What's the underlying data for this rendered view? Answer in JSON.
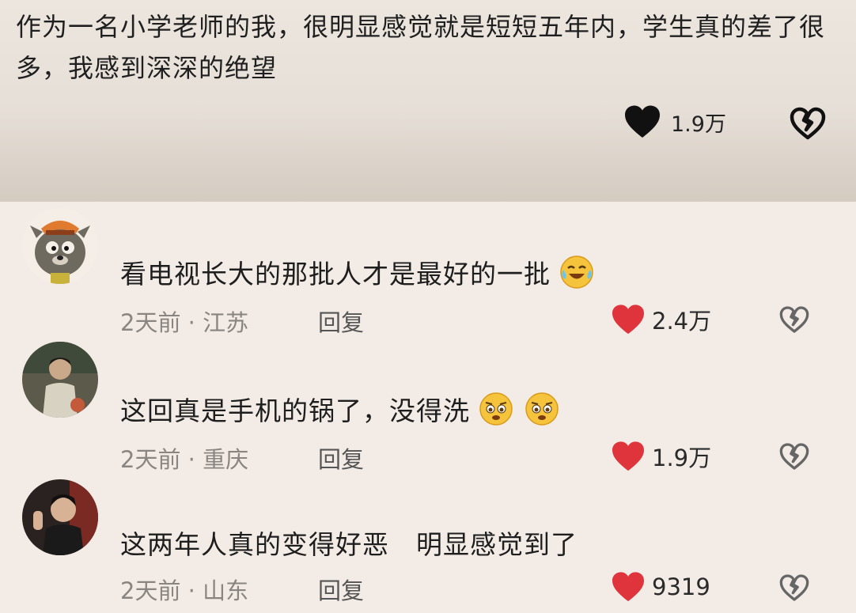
{
  "post": {
    "text": "作为一名小学老师的我，很明显感觉就是短短五年内，学生真的差了很多，我感到深深的绝望",
    "likes": "1.9万",
    "like_icon": "black-heart-icon",
    "dislike_icon": "broken-heart-icon"
  },
  "comments": [
    {
      "text": "看电视长大的那批人才是最好的一批",
      "time": "2天前",
      "location": "江苏",
      "reply_label": "回复",
      "likes": "2.4万",
      "emojis": [
        "crying-laugh-emoji"
      ]
    },
    {
      "text": "这回真是手机的锅了，没得洗",
      "time": "2天前",
      "location": "重庆",
      "reply_label": "回复",
      "likes": "1.9万",
      "emojis": [
        "pleading-emoji",
        "pleading-emoji"
      ]
    },
    {
      "text": "这两年人真的变得好恶　明显感觉到了",
      "time": "2天前",
      "location": "山东",
      "reply_label": "回复",
      "likes": "9319",
      "emojis": []
    }
  ],
  "meta_separator": " · ",
  "colors": {
    "like_red": "#e0343c",
    "background": "#f3ece6",
    "meta_gray": "#8a8580"
  }
}
